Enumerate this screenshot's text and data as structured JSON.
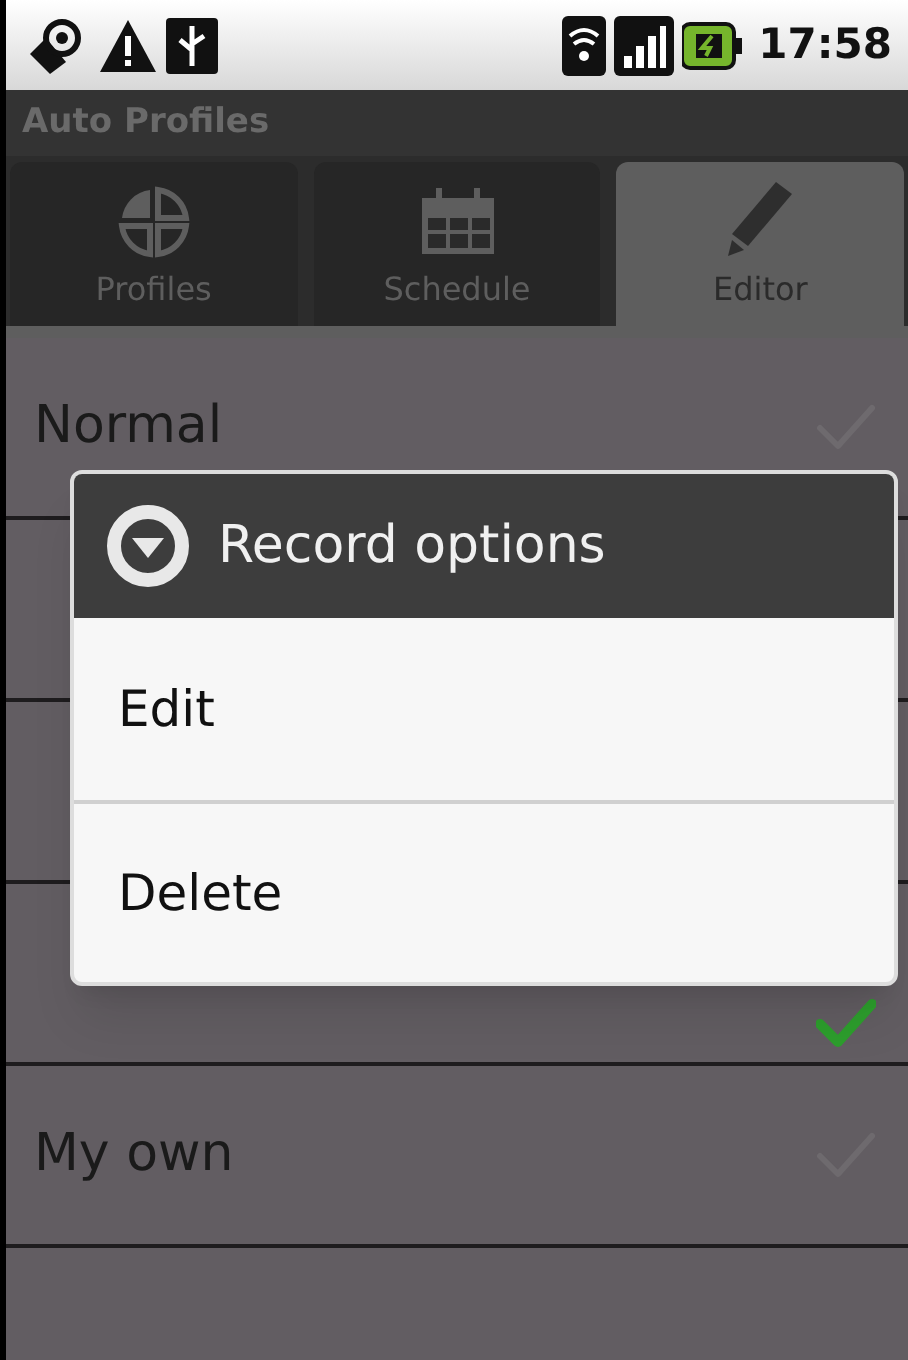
{
  "status_bar": {
    "time": "17:58"
  },
  "app_title": "Auto Profiles",
  "tabs": [
    {
      "label": "Profiles",
      "selected": false
    },
    {
      "label": "Schedule",
      "selected": false
    },
    {
      "label": "Editor",
      "selected": true
    }
  ],
  "profiles": [
    {
      "name": "Normal",
      "checked": false
    },
    {
      "checked": true
    },
    {
      "name": "My own",
      "checked": false
    }
  ],
  "dialog": {
    "title": "Record options",
    "items": [
      "Edit",
      "Delete"
    ]
  }
}
